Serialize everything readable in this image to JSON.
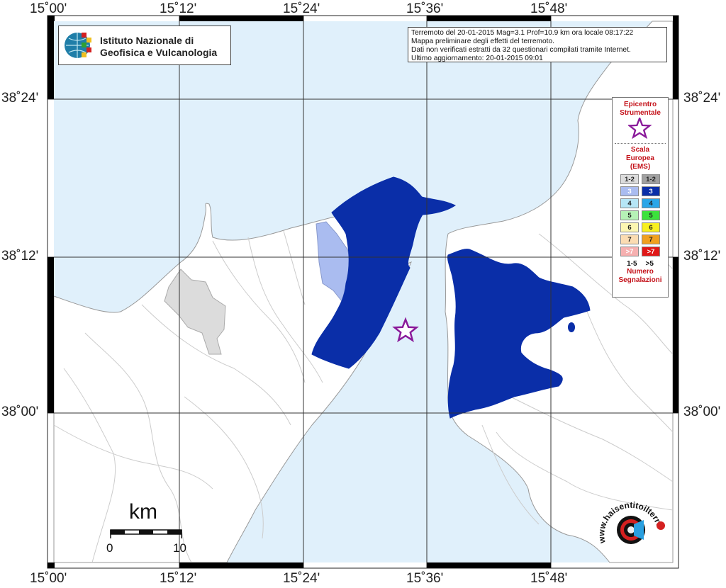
{
  "info_box": {
    "line1": "Terremoto del 20-01-2015 Mag=3.1 Prof=10.9 km ora locale 08:17:22",
    "line2": "Mappa preliminare degli effetti del terremoto.",
    "line3": "Dati non verificati estratti da 32 questionari compilati tramite Internet.",
    "line4": "Ultimo aggiornamento: 20-01-2015 09:01"
  },
  "institute": {
    "line1": "Istituto Nazionale di",
    "line2": "Geofisica e Vulcanologia"
  },
  "axes": {
    "lon_ticks": [
      "15˚00'",
      "15˚12'",
      "15˚24'",
      "15˚36'",
      "15˚48'"
    ],
    "lat_ticks": [
      "38˚24'",
      "38˚12'",
      "38˚00'"
    ]
  },
  "legend": {
    "epicenter_title_1": "Epicentro",
    "epicenter_title_2": "Strumentale",
    "scale_title_1": "Scala",
    "scale_title_2": "Europea",
    "scale_title_3": "(EMS)",
    "rows": [
      {
        "label": "1-2",
        "light": "#dcdcdc",
        "dark": "#a0a0a0",
        "light_text": "#222",
        "dark_text": "#222"
      },
      {
        "label": "3",
        "light": "#aabcf0",
        "dark": "#0a2ea8",
        "light_text": "#ffffff",
        "dark_text": "#ffffff"
      },
      {
        "label": "4",
        "light": "#b6e6f6",
        "dark": "#2aa6e8",
        "light_text": "#222",
        "dark_text": "#222"
      },
      {
        "label": "5",
        "light": "#b6f2b6",
        "dark": "#3ce23c",
        "light_text": "#222",
        "dark_text": "#222"
      },
      {
        "label": "6",
        "light": "#fcf6b2",
        "dark": "#f8f020",
        "light_text": "#222",
        "dark_text": "#222"
      },
      {
        "label": "7",
        "light": "#fbdcb2",
        "dark": "#f0a020",
        "light_text": "#222",
        "dark_text": "#222"
      },
      {
        "label": ">7",
        "light": "#f6b0b0",
        "dark": "#e01818",
        "light_text": "#ffffff",
        "dark_text": "#ffffff"
      }
    ],
    "count_low": "1-5",
    "count_high": ">5",
    "count_title_1": "Numero",
    "count_title_2": "Segnalazioni"
  },
  "scale_bar": {
    "unit": "km",
    "start": "0",
    "end": "10"
  },
  "watermark": {
    "text": "www.haisentitoilterremoto.it"
  },
  "colors": {
    "sea": "#e0f0fb",
    "land": "#ffffff",
    "intensity_3_dark": "#0a2ea8",
    "intensity_3_light": "#aabcf0",
    "intensity_1_2_light": "#dcdcdc",
    "epicenter": "#8a1a9a"
  }
}
